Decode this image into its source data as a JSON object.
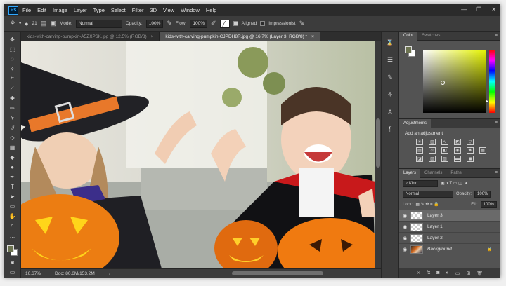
{
  "app": {
    "logo": "Ps"
  },
  "menu": [
    "File",
    "Edit",
    "Image",
    "Layer",
    "Type",
    "Select",
    "Filter",
    "3D",
    "View",
    "Window",
    "Help"
  ],
  "window_controls": [
    "—",
    "❐",
    "✕"
  ],
  "options_bar": {
    "brush_size": "21",
    "mode_label": "Mode:",
    "mode_value": "Normal",
    "opacity_label": "Opacity:",
    "opacity_value": "100%",
    "flow_label": "Flow:",
    "flow_value": "100%",
    "aligned_label": "Aligned",
    "aligned_checked": true,
    "impressionist_label": "Impressionist",
    "impressionist_checked": false
  },
  "document_tabs": [
    {
      "label": "kids-with-carving-pumpkin-A5ZXP6K.jpg @ 12.5% (RGB/8)",
      "active": false,
      "close": "×"
    },
    {
      "label": "kids-with-carving-pumpkin-CJPDH8R.jpg @ 16.7% (Layer 3, RGB/8) *",
      "active": true,
      "close": "×"
    }
  ],
  "status_bar": {
    "zoom": "16.67%",
    "doc": "Doc: 80.6M/153.2M",
    "arrow": "›"
  },
  "panels": {
    "color": {
      "tabs": [
        "Color",
        "Swatches"
      ],
      "menu": "≡",
      "fg_color": "#6c7350",
      "bg_color": "#ffffff"
    },
    "adjustments": {
      "tabs": [
        "Adjustments"
      ],
      "title": "Add an adjustment",
      "menu": "≡"
    },
    "layers": {
      "tabs": [
        "Layers",
        "Channels",
        "Paths"
      ],
      "menu": "≡",
      "filter_label": "Kind",
      "blend_mode": "Normal",
      "opacity_label": "Opacity:",
      "opacity_value": "100%",
      "lock_label": "Lock:",
      "fill_label": "Fill:",
      "fill_value": "100%",
      "items": [
        {
          "name": "Layer 3",
          "selected": true
        },
        {
          "name": "Layer 1",
          "selected": false
        },
        {
          "name": "Layer 2",
          "selected": false
        },
        {
          "name": "Background",
          "selected": false
        }
      ],
      "footer_icons": [
        "link-icon",
        "fx-icon",
        "mask-icon",
        "adjustment-icon",
        "folder-icon",
        "new-layer-icon",
        "trash-icon"
      ]
    }
  },
  "colors": {
    "accent": "#31a8ff",
    "fg": "#6c7350"
  }
}
